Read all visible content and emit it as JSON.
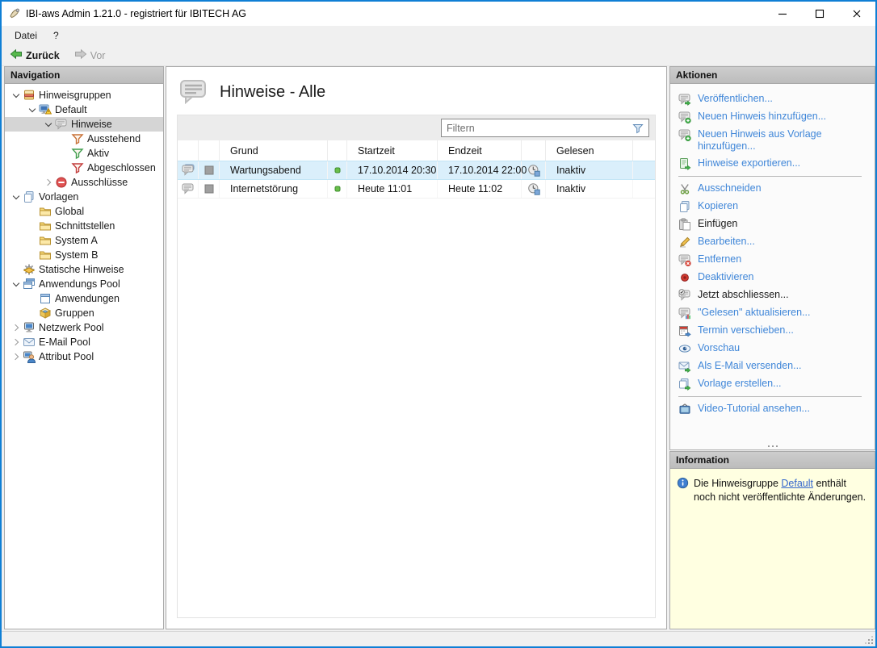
{
  "window": {
    "title": "IBI-aws Admin 1.21.0 - registriert für IBITECH AG"
  },
  "menu": {
    "items": [
      "Datei",
      "?"
    ]
  },
  "toolbar": {
    "back_label": "Zurück",
    "forward_label": "Vor"
  },
  "navigation": {
    "header": "Navigation",
    "tree": [
      {
        "label": "Hinweisgruppen",
        "level": 0,
        "state": "expanded",
        "icon": "notice-groups",
        "selected": false
      },
      {
        "label": "Default",
        "level": 1,
        "state": "expanded",
        "icon": "notice-group-default",
        "selected": false
      },
      {
        "label": "Hinweise",
        "level": 2,
        "state": "expanded",
        "icon": "notices",
        "selected": true
      },
      {
        "label": "Ausstehend",
        "level": 3,
        "state": "none",
        "icon": "funnel-orange",
        "selected": false
      },
      {
        "label": "Aktiv",
        "level": 3,
        "state": "none",
        "icon": "funnel-green",
        "selected": false
      },
      {
        "label": "Abgeschlossen",
        "level": 3,
        "state": "none",
        "icon": "funnel-red",
        "selected": false
      },
      {
        "label": "Ausschlüsse",
        "level": 2,
        "state": "collapsed",
        "icon": "exclusions",
        "selected": false
      },
      {
        "label": "Vorlagen",
        "level": 0,
        "state": "expanded",
        "icon": "templates",
        "selected": false
      },
      {
        "label": "Global",
        "level": 1,
        "state": "none",
        "icon": "folder",
        "selected": false
      },
      {
        "label": "Schnittstellen",
        "level": 1,
        "state": "none",
        "icon": "folder",
        "selected": false
      },
      {
        "label": "System A",
        "level": 1,
        "state": "none",
        "icon": "folder",
        "selected": false
      },
      {
        "label": "System B",
        "level": 1,
        "state": "none",
        "icon": "folder",
        "selected": false
      },
      {
        "label": "Statische Hinweise",
        "level": 0,
        "state": "none",
        "icon": "static-notices",
        "selected": false
      },
      {
        "label": "Anwendungs Pool",
        "level": 0,
        "state": "expanded",
        "icon": "app-pool",
        "selected": false
      },
      {
        "label": "Anwendungen",
        "level": 1,
        "state": "none",
        "icon": "application",
        "selected": false
      },
      {
        "label": "Gruppen",
        "level": 1,
        "state": "none",
        "icon": "groups",
        "selected": false
      },
      {
        "label": "Netzwerk Pool",
        "level": 0,
        "state": "collapsed",
        "icon": "network-pool",
        "selected": false
      },
      {
        "label": "E-Mail Pool",
        "level": 0,
        "state": "collapsed",
        "icon": "email-pool",
        "selected": false
      },
      {
        "label": "Attribut Pool",
        "level": 0,
        "state": "collapsed",
        "icon": "attribute-pool",
        "selected": false
      }
    ]
  },
  "main": {
    "title": "Hinweise - Alle",
    "title_icon": "notices-large",
    "filter_placeholder": "Filtern",
    "table": {
      "columns": [
        "",
        "",
        "Grund",
        "",
        "Startzeit",
        "Endzeit",
        "",
        "Gelesen",
        ""
      ],
      "rows": [
        {
          "icon": "notice-double",
          "state_icon": "gray-square",
          "grund": "Wartungsabend",
          "status_icon": "green-dot",
          "startzeit": "17.10.2014 20:30",
          "endzeit": "17.10.2014 22:00",
          "gelesen_icon": "clock",
          "gelesen": "Inaktiv",
          "selected": true
        },
        {
          "icon": "notice-single",
          "state_icon": "gray-square",
          "grund": "Internetstörung",
          "status_icon": "green-dot",
          "startzeit": "Heute 11:01",
          "endzeit": "Heute 11:02",
          "gelesen_icon": "clock",
          "gelesen": "Inaktiv",
          "selected": false
        }
      ]
    }
  },
  "actions": {
    "header": "Aktionen",
    "items": [
      {
        "icon": "publish",
        "label": "Veröffentlichen...",
        "enabled": true
      },
      {
        "icon": "add-notice",
        "label": "Neuen Hinweis hinzufügen...",
        "enabled": true
      },
      {
        "icon": "add-from-template",
        "label": "Neuen Hinweis aus Vorlage hinzufügen...",
        "enabled": true
      },
      {
        "icon": "export-notices",
        "label": "Hinweise exportieren...",
        "enabled": true
      },
      {
        "separator": true
      },
      {
        "icon": "cut",
        "label": "Ausschneiden",
        "enabled": true
      },
      {
        "icon": "copy",
        "label": "Kopieren",
        "enabled": true
      },
      {
        "icon": "paste",
        "label": "Einfügen",
        "enabled": false
      },
      {
        "icon": "edit",
        "label": "Bearbeiten...",
        "enabled": true
      },
      {
        "icon": "remove",
        "label": "Entfernen",
        "enabled": true
      },
      {
        "icon": "deactivate",
        "label": "Deaktivieren",
        "enabled": true
      },
      {
        "icon": "finish-now",
        "label": "Jetzt abschliessen...",
        "enabled": false
      },
      {
        "icon": "update-read",
        "label": "\"Gelesen\" aktualisieren...",
        "enabled": true
      },
      {
        "icon": "reschedule",
        "label": "Termin verschieben...",
        "enabled": true
      },
      {
        "icon": "preview",
        "label": "Vorschau",
        "enabled": true
      },
      {
        "icon": "send-email",
        "label": "Als E-Mail versenden...",
        "enabled": true
      },
      {
        "icon": "create-template",
        "label": "Vorlage erstellen...",
        "enabled": true
      },
      {
        "separator": true
      },
      {
        "icon": "video-tutorial",
        "label": "Video-Tutorial ansehen...",
        "enabled": true
      }
    ]
  },
  "information": {
    "header": "Information",
    "text_before": "Die Hinweisgruppe ",
    "link": "Default",
    "text_after": " enthält noch nicht veröffentlichte Änderungen."
  },
  "colors": {
    "window_border": "#0f7fd5",
    "action_link": "#3f86d8",
    "selected_row_bg": "#daeffb",
    "tree_selection_bg": "#d5d5d5",
    "info_panel_bg": "#ffffe1",
    "panel_header_bg": "#c4c4c4",
    "status_green": "#6abf4b"
  }
}
